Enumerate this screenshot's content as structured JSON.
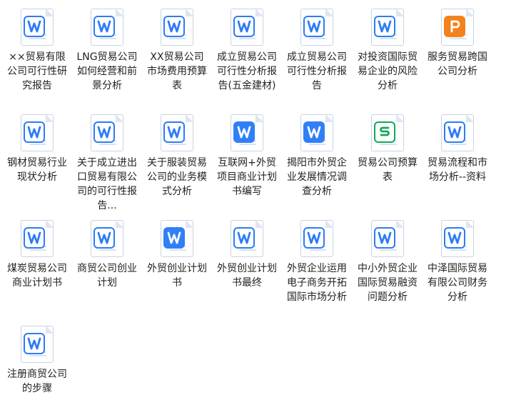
{
  "colors": {
    "word_blue": "#2c7cf6",
    "sheet_green": "#11a85a",
    "ppt_orange": "#f3821e"
  },
  "files": [
    {
      "label": "××贸易有限公司可行性研究报告",
      "icon": "word-icon"
    },
    {
      "label": "LNG贸易公司如何经营和前景分析",
      "icon": "word-icon"
    },
    {
      "label": "XX贸易公司市场费用预算表",
      "icon": "word-icon"
    },
    {
      "label": "成立贸易公司可行性分析报告(五金建材)",
      "icon": "word-icon"
    },
    {
      "label": "成立贸易公司可行性分析报告",
      "icon": "word-icon"
    },
    {
      "label": "对投资国际贸易企业的风险分析",
      "icon": "word-icon"
    },
    {
      "label": "服务贸易跨国公司分析",
      "icon": "presentation-icon"
    },
    {
      "label": "钢材贸易行业现状分析",
      "icon": "word-icon"
    },
    {
      "label": "关于成立进出口贸易有限公司的可行性报告...",
      "icon": "word-icon"
    },
    {
      "label": "关于服装贸易公司的业务模式分析",
      "icon": "word-icon"
    },
    {
      "label": "互联网+外贸项目商业计划书编写",
      "icon": "word-solid-icon"
    },
    {
      "label": "揭阳市外贸企业发展情况调查分析",
      "icon": "word-solid-icon"
    },
    {
      "label": "贸易公司预算表",
      "icon": "spreadsheet-icon"
    },
    {
      "label": "贸易流程和市场分析--资料",
      "icon": "word-icon"
    },
    {
      "label": "煤炭贸易公司商业计划书",
      "icon": "word-icon"
    },
    {
      "label": "商贸公司创业计划",
      "icon": "word-icon"
    },
    {
      "label": "外贸创业计划书",
      "icon": "word-solid-icon"
    },
    {
      "label": "外贸创业计划书最终",
      "icon": "word-icon"
    },
    {
      "label": "外贸企业运用电子商务开拓国际市场分析",
      "icon": "word-icon"
    },
    {
      "label": "中小外贸企业国际贸易融资问题分析",
      "icon": "word-icon"
    },
    {
      "label": "中泽国际贸易有限公司财务分析",
      "icon": "word-icon"
    },
    {
      "label": "注册商贸公司的步骤",
      "icon": "word-icon"
    }
  ]
}
